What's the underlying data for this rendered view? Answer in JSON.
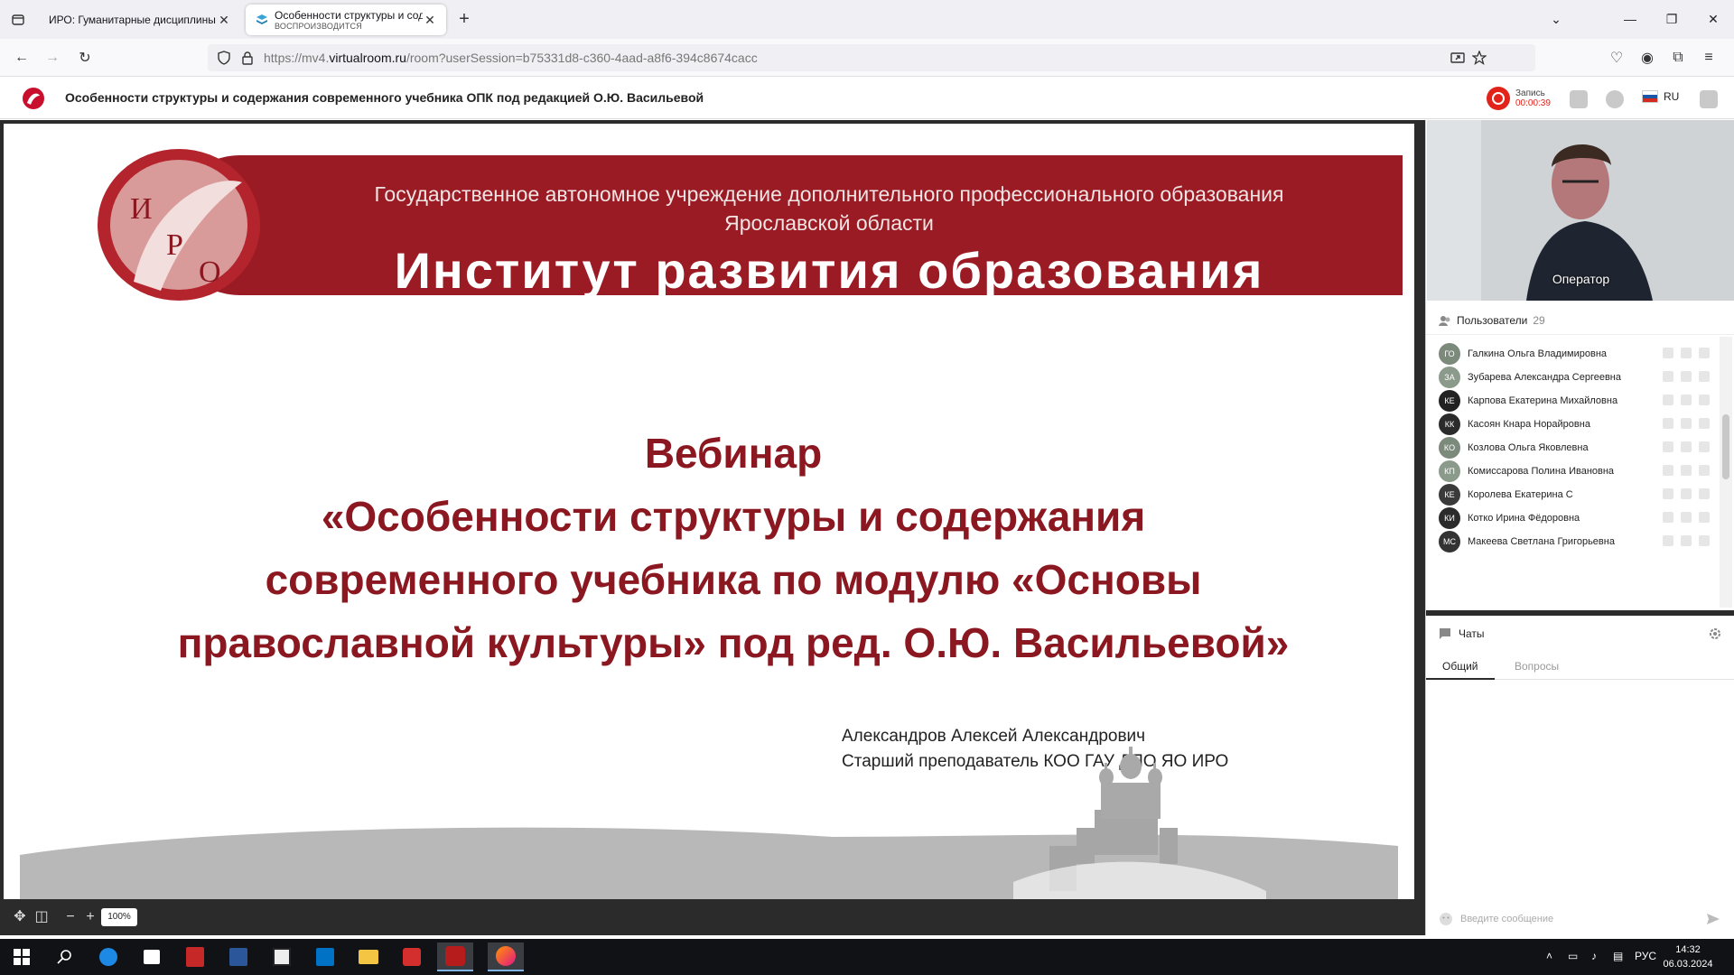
{
  "browser": {
    "tabs": [
      {
        "title": "ИРО: Гуманитарные дисциплины"
      },
      {
        "title": "Особенности структуры и содержания",
        "subtitle": "ВОСПРОИЗВОДИТСЯ"
      }
    ],
    "url_prefix": "https://mv4.",
    "url_domain": "virtualroom.ru",
    "url_path": "/room?userSession=b75331d8-c360-4aad-a8f6-394c8674cacc"
  },
  "app": {
    "title": "Особенности структуры и содержания современного учебника ОПК под редакцией О.Ю. Васильевой",
    "record_label": "Запись",
    "record_time": "00:00:39",
    "language": "RU"
  },
  "slide": {
    "banner_line1": "Государственное автономное учреждение дополнительного профессионального образования",
    "banner_line2": "Ярославской области",
    "banner_main": "Институт развития образования",
    "emblem_letters": [
      "И",
      "Р",
      "О"
    ],
    "title_lines": [
      "Вебинар",
      "«Особенности структуры и содержания",
      "современного учебника по модулю «Основы",
      "православной культуры» под ред. О.Ю. Васильевой»"
    ],
    "author_name": "Александров Алексей Александрович",
    "author_position": "Старший преподаватель КОО ГАУ ДПО ЯО ИРО"
  },
  "controls": {
    "zoom": "100%"
  },
  "video": {
    "label": "Оператор"
  },
  "users": {
    "label": "Пользователи",
    "count": "29",
    "list": [
      {
        "initials": "ГО",
        "name": "Галкина Ольга Владимировна",
        "color": "#7b8a7b"
      },
      {
        "initials": "ЗА",
        "name": "Зубарева Александра Сергеевна",
        "color": "#8c9a8c"
      },
      {
        "initials": "КЕ",
        "name": "Карпова Екатерина Михайловна",
        "color": "#222222"
      },
      {
        "initials": "КК",
        "name": "Касоян Кнара Норайровна",
        "color": "#2b2b2b"
      },
      {
        "initials": "КО",
        "name": "Козлова Ольга Яковлевна",
        "color": "#7b8a7b"
      },
      {
        "initials": "КП",
        "name": "Комиссарова Полина Ивановна",
        "color": "#8c9a8c"
      },
      {
        "initials": "КЕ",
        "name": "Королева Екатерина С",
        "color": "#3a3a3a"
      },
      {
        "initials": "КИ",
        "name": "Котко Ирина Фёдоровна",
        "color": "#2b2b2b"
      },
      {
        "initials": "МС",
        "name": "Макеева Светлана Григорьевна",
        "color": "#333333"
      }
    ]
  },
  "chat": {
    "label": "Чаты",
    "tabs": [
      "Общий",
      "Вопросы"
    ],
    "input_placeholder": "Введите сообщение"
  },
  "taskbar": {
    "lang": "РУС",
    "time": "14:32",
    "date": "06.03.2024"
  }
}
